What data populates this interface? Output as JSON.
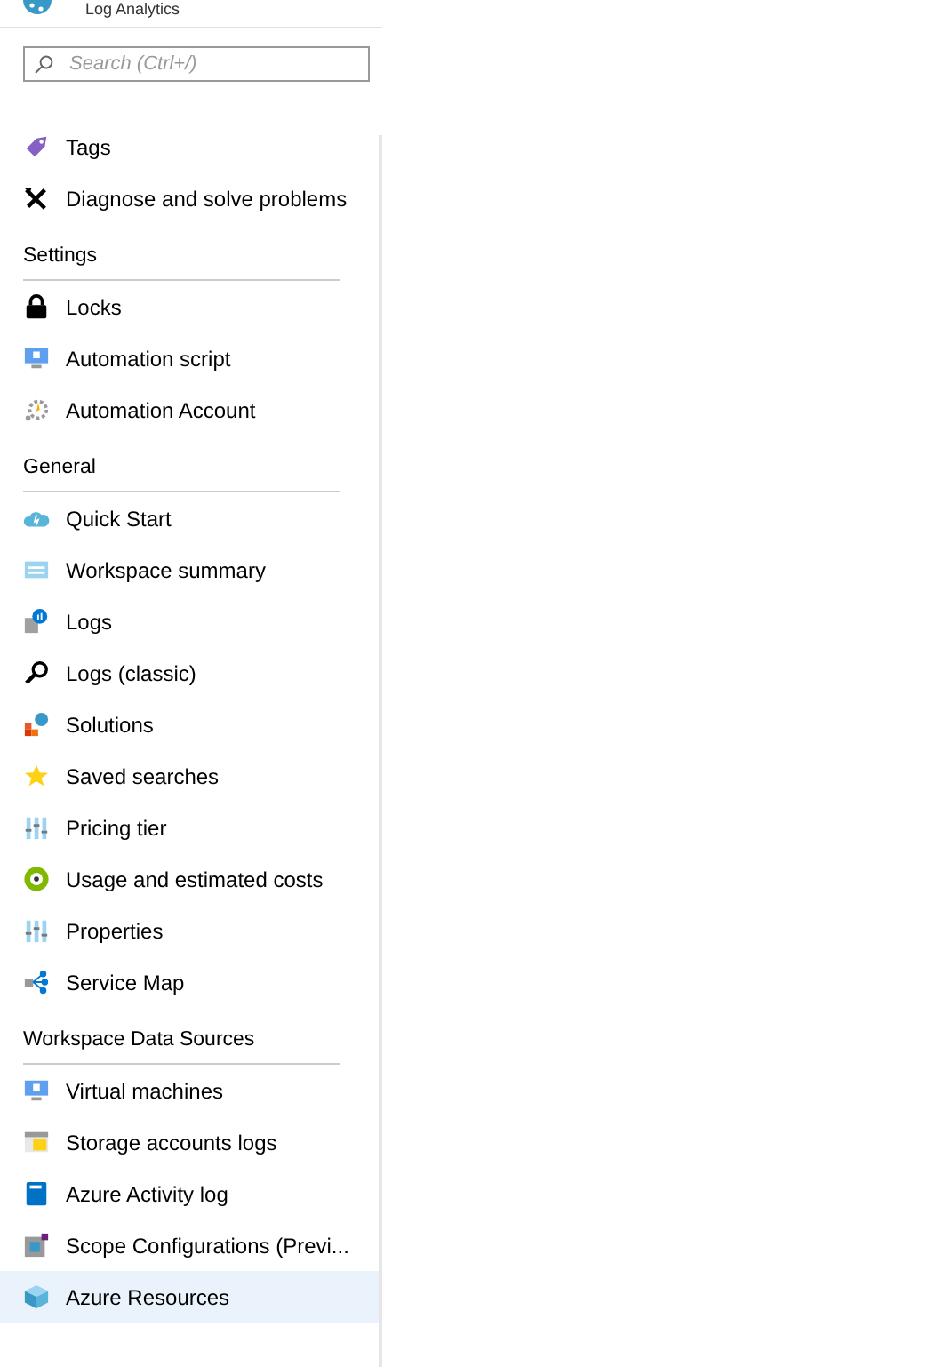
{
  "header": {
    "title": "Log Analytics"
  },
  "search": {
    "placeholder": "Search (Ctrl+/)"
  },
  "sections": [
    {
      "items": [
        {
          "label": "Tags",
          "kind": "tag",
          "selected": false
        },
        {
          "label": "Diagnose and solve problems",
          "kind": "tools",
          "selected": false
        }
      ]
    },
    {
      "title": "Settings",
      "items": [
        {
          "label": "Locks",
          "kind": "lock",
          "selected": false
        },
        {
          "label": "Automation script",
          "kind": "monitor",
          "selected": false
        },
        {
          "label": "Automation Account",
          "kind": "gear",
          "selected": false
        }
      ]
    },
    {
      "title": "General",
      "items": [
        {
          "label": "Quick Start",
          "kind": "cloud",
          "selected": false
        },
        {
          "label": "Workspace summary",
          "kind": "summary",
          "selected": false
        },
        {
          "label": "Logs",
          "kind": "logs",
          "selected": false
        },
        {
          "label": "Logs (classic)",
          "kind": "magnifier",
          "selected": false
        },
        {
          "label": "Solutions",
          "kind": "solutions",
          "selected": false
        },
        {
          "label": "Saved searches",
          "kind": "star",
          "selected": false
        },
        {
          "label": "Pricing tier",
          "kind": "bars",
          "selected": false
        },
        {
          "label": "Usage and estimated costs",
          "kind": "ring",
          "selected": false
        },
        {
          "label": "Properties",
          "kind": "bars",
          "selected": false
        },
        {
          "label": "Service Map",
          "kind": "map",
          "selected": false
        }
      ]
    },
    {
      "title": "Workspace Data Sources",
      "items": [
        {
          "label": "Virtual machines",
          "kind": "monitor",
          "selected": false
        },
        {
          "label": "Storage accounts logs",
          "kind": "table",
          "selected": false
        },
        {
          "label": "Azure Activity log",
          "kind": "book",
          "selected": false
        },
        {
          "label": "Scope Configurations (Previ...",
          "kind": "scope",
          "selected": false
        },
        {
          "label": "Azure Resources",
          "kind": "cube",
          "selected": true
        }
      ]
    }
  ]
}
